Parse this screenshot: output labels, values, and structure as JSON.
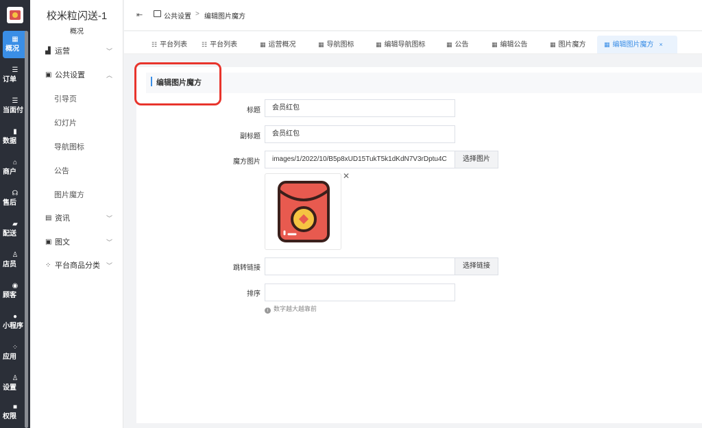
{
  "rail": {
    "items": [
      {
        "label": "概况",
        "icon": "grid-icon"
      },
      {
        "label": "订单",
        "icon": "list-icon"
      },
      {
        "label": "当面付",
        "icon": "list-icon"
      },
      {
        "label": "数据",
        "icon": "bar-chart-icon"
      },
      {
        "label": "商户",
        "icon": "store-icon"
      },
      {
        "label": "售后",
        "icon": "headset-icon"
      },
      {
        "label": "配送",
        "icon": "truck-icon"
      },
      {
        "label": "店员",
        "icon": "users-icon"
      },
      {
        "label": "顾客",
        "icon": "user-circle-icon"
      },
      {
        "label": "小程序",
        "icon": "chat-icon"
      },
      {
        "label": "应用",
        "icon": "apps-icon"
      },
      {
        "label": "设置",
        "icon": "user-gear-icon"
      },
      {
        "label": "权限",
        "icon": "lock-icon"
      }
    ]
  },
  "sidebar": {
    "store_name": "校米粒闪送-1",
    "store_sub": "概况",
    "menus": {
      "yunying": "运营",
      "gonggong": "公共设置",
      "yindao": "引导页",
      "huandeng": "幻灯片",
      "daohang": "导航图标",
      "gonggao": "公告",
      "mofang": "图片魔方",
      "zixun": "资讯",
      "tuwen": "图文",
      "fenlei": "平台商品分类"
    }
  },
  "header": {
    "crumb1": "公共设置",
    "separator": ">",
    "crumb2": "编辑图片魔方"
  },
  "tabs": [
    {
      "label": "平台列表"
    },
    {
      "label": "平台列表"
    },
    {
      "label": "运营概况"
    },
    {
      "label": "导航图标"
    },
    {
      "label": "编辑导航图标"
    },
    {
      "label": "公告"
    },
    {
      "label": "编辑公告"
    },
    {
      "label": "图片魔方"
    },
    {
      "label": "编辑图片魔方",
      "active": true
    }
  ],
  "form": {
    "section_title": "编辑图片魔方",
    "title_label": "标题",
    "title_value": "会员红包",
    "subtitle_label": "副标题",
    "subtitle_value": "会员红包",
    "image_label": "魔方图片",
    "image_value": "images/1/2022/10/B5p8xUD15TukT5k1dKdN7V3rDptu4C",
    "choose_image": "选择图片",
    "link_label": "跳转链接",
    "link_value": "",
    "choose_link": "选择链接",
    "sort_label": "排序",
    "sort_value": "",
    "sort_hint": "数字越大越靠前"
  },
  "colors": {
    "accent": "#3a8ee6",
    "highlight": "#e8342c",
    "rail_bg": "#2b2f38"
  }
}
